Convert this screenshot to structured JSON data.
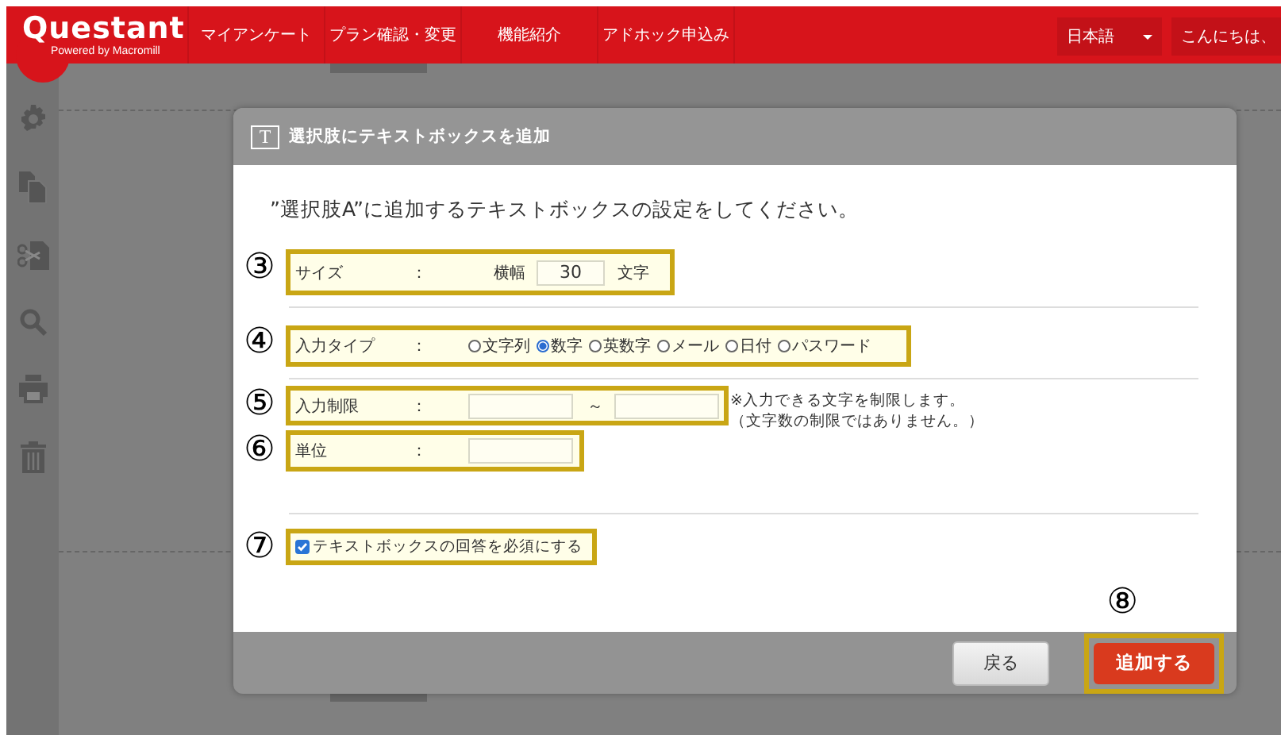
{
  "header": {
    "logo": "Questant",
    "tagline": "Powered by Macromill",
    "nav": [
      "マイアンケート",
      "プラン確認・変更",
      "機能紹介",
      "アドホック申込み"
    ],
    "language": "日本語",
    "greeting": "こんにちは、"
  },
  "dialog": {
    "title_icon": "T",
    "title": "選択肢にテキストボックスを追加",
    "intro": "”選択肢A”に追加するテキストボックスの設定をしてください。",
    "size": {
      "marker": "③",
      "label": "サイズ",
      "colon": "：",
      "width_label": "横幅",
      "value": "30",
      "unit": "文字"
    },
    "input_type": {
      "marker": "④",
      "label": "入力タイプ",
      "colon": "：",
      "options": [
        {
          "label": "文字列",
          "selected": false
        },
        {
          "label": "数字",
          "selected": true
        },
        {
          "label": "英数字",
          "selected": false
        },
        {
          "label": "メール",
          "selected": false
        },
        {
          "label": "日付",
          "selected": false
        },
        {
          "label": "パスワード",
          "selected": false
        }
      ]
    },
    "limit": {
      "marker": "⑤",
      "label": "入力制限",
      "colon": "：",
      "separator": "～",
      "note": [
        "※入力できる文字を制限します。",
        "（文字数の制限ではありません。）"
      ]
    },
    "unit": {
      "marker": "⑥",
      "label": "単位",
      "colon": "："
    },
    "required": {
      "marker": "⑦",
      "label": "テキストボックスの回答を必須にする",
      "checked": true
    },
    "back_button": "戻る",
    "add_marker": "⑧",
    "add_button": "追加する"
  }
}
